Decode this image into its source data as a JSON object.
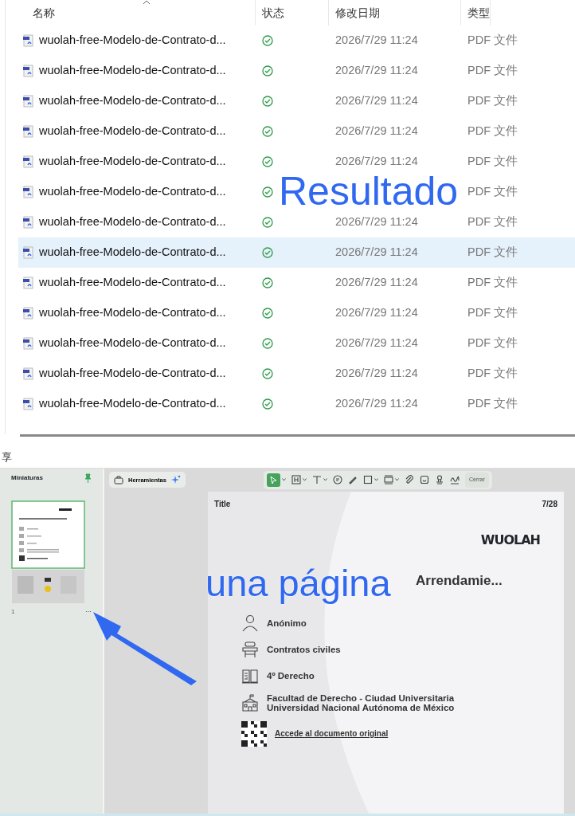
{
  "file_list": {
    "columns": [
      "名称",
      "状态",
      "修改日期",
      "类型"
    ],
    "rows": [
      {
        "name": "wuolah-free-Modelo-de-Contrato-d...",
        "date": "2026/7/29 11:24",
        "type": "PDF 文件",
        "selected": false
      },
      {
        "name": "wuolah-free-Modelo-de-Contrato-d...",
        "date": "2026/7/29 11:24",
        "type": "PDF 文件",
        "selected": false
      },
      {
        "name": "wuolah-free-Modelo-de-Contrato-d...",
        "date": "2026/7/29 11:24",
        "type": "PDF 文件",
        "selected": false
      },
      {
        "name": "wuolah-free-Modelo-de-Contrato-d...",
        "date": "2026/7/29 11:24",
        "type": "PDF 文件",
        "selected": false
      },
      {
        "name": "wuolah-free-Modelo-de-Contrato-d...",
        "date": "2026/7/29 11:24",
        "type": "PDF 文件",
        "selected": false
      },
      {
        "name": "wuolah-free-Modelo-de-Contrato-d...",
        "type": "PDF 文件",
        "selected": false
      },
      {
        "name": "wuolah-free-Modelo-de-Contrato-d...",
        "date": "2026/7/29 11:24",
        "type": "PDF 文件",
        "selected": false
      },
      {
        "name": "wuolah-free-Modelo-de-Contrato-d...",
        "date": "2026/7/29 11:24",
        "type": "PDF 文件",
        "selected": true
      },
      {
        "name": "wuolah-free-Modelo-de-Contrato-d...",
        "date": "2026/7/29 11:24",
        "type": "PDF 文件",
        "selected": false
      },
      {
        "name": "wuolah-free-Modelo-de-Contrato-d...",
        "date": "2026/7/29 11:24",
        "type": "PDF 文件",
        "selected": false
      },
      {
        "name": "wuolah-free-Modelo-de-Contrato-d...",
        "date": "2026/7/29 11:24",
        "type": "PDF 文件",
        "selected": false
      },
      {
        "name": "wuolah-free-Modelo-de-Contrato-d...",
        "date": "2026/7/29 11:24",
        "type": "PDF 文件",
        "selected": false
      },
      {
        "name": "wuolah-free-Modelo-de-Contrato-d...",
        "date": "2026/7/29 11:24",
        "type": "PDF 文件",
        "selected": false
      }
    ]
  },
  "share_label": "享",
  "viewer": {
    "sidebar": {
      "title": "Miniaturas",
      "page_number": "1",
      "more": "···"
    },
    "tools_button": "Herramientas",
    "close_button": "Cerrar",
    "page": {
      "header_title": "Title",
      "page_counter": "7/28",
      "logo": "WUOLAH",
      "title": "Arrendamie...",
      "meta": [
        {
          "kind": "author",
          "lines": [
            "Anónimo"
          ]
        },
        {
          "kind": "subject",
          "lines": [
            "Contratos civiles"
          ]
        },
        {
          "kind": "course",
          "lines": [
            "4º Derecho"
          ]
        },
        {
          "kind": "school",
          "lines": [
            "Facultad de Derecho - Ciudad Universitaria",
            "Universidad Nacional Autónoma de México"
          ]
        }
      ],
      "link": "Accede al documento original"
    }
  },
  "annotations": [
    {
      "text": "Resultado"
    },
    {
      "text": "una página"
    }
  ]
}
